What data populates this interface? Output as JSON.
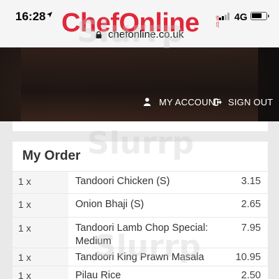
{
  "status_bar": {
    "time": "16:28",
    "network": "4G"
  },
  "browser": {
    "url": "chefonline.co.uk"
  },
  "header": {
    "logo_text": "ChefOnline",
    "logo_tld": ".co.uk",
    "my_account_label": "MY ACCOUNT",
    "sign_out_label": "SIGN OUT"
  },
  "order": {
    "title": "My Order",
    "items": [
      {
        "qty": "1 x",
        "name": "Tandoori Chicken (S)",
        "price": "3.15"
      },
      {
        "qty": "1 x",
        "name": "Onion Bhaji (S)",
        "price": "2.65"
      },
      {
        "qty": "1 x",
        "name": "Tandoori Lamb Chop Special: Medium",
        "price": "7.95"
      },
      {
        "qty": "1 x",
        "name": "Tandoori King Prawn Masala",
        "price": "10.95"
      },
      {
        "qty": "1 x",
        "name": "Pilau Rice",
        "price": "2.50"
      }
    ]
  },
  "watermark": {
    "text": "Slurrp"
  },
  "colors": {
    "brand_red": "#e0283a",
    "header_dark": "#1c1513",
    "page_bg": "#e9e9e9"
  }
}
